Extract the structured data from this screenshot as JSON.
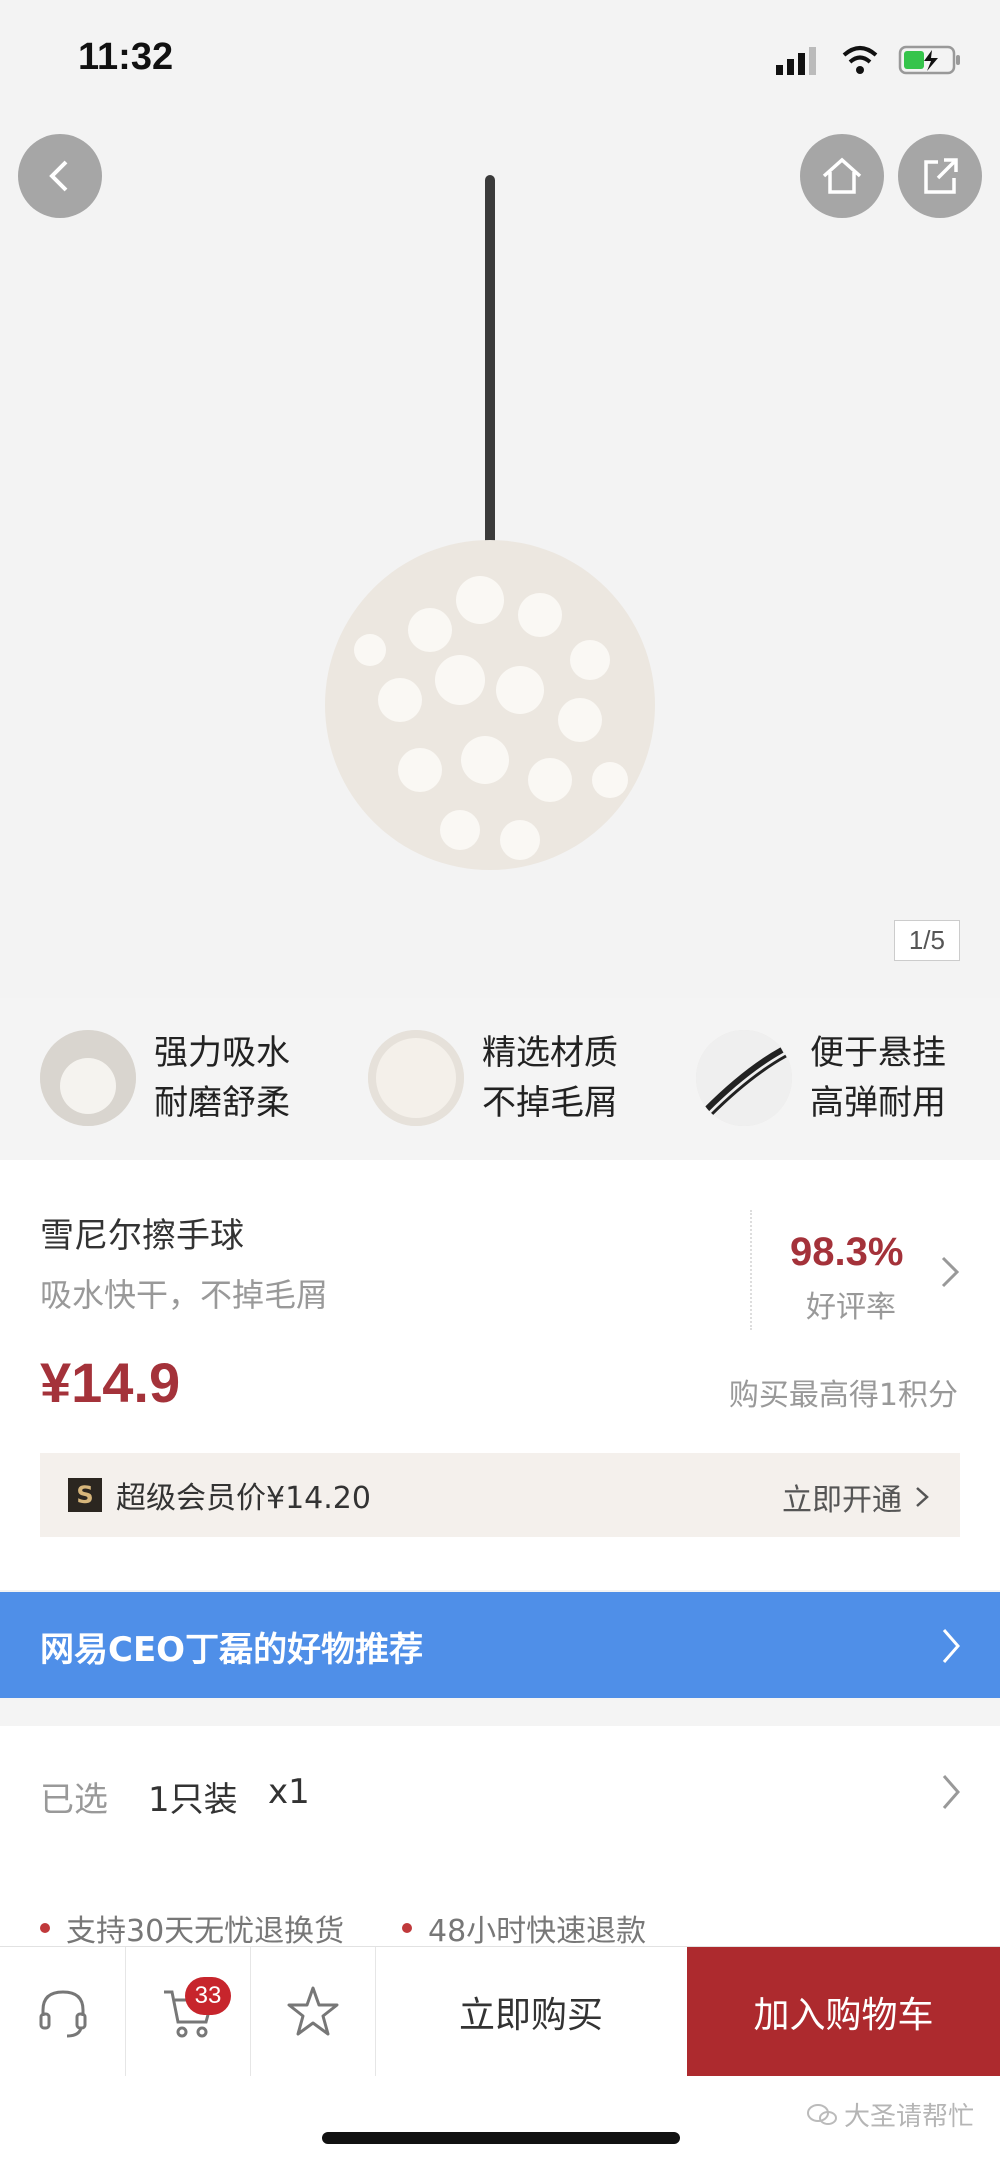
{
  "status_bar": {
    "time": "11:32"
  },
  "gallery": {
    "counter": "1/5"
  },
  "features": [
    {
      "line1": "强力吸水",
      "line2": "耐磨舒柔",
      "icon": "water-absorb-thumb"
    },
    {
      "line1": "精选材质",
      "line2": "不掉毛屑",
      "icon": "material-thumb"
    },
    {
      "line1": "便于悬挂",
      "line2": "高弹耐用",
      "icon": "hanging-cord-thumb"
    }
  ],
  "product": {
    "title": "雪尼尔擦手球",
    "subtitle": "吸水快干，不掉毛屑",
    "rating_value": "98.3%",
    "rating_label": "好评率",
    "price": "¥14.9",
    "points_text": "购买最高得1积分",
    "vip_text": "超级会员价¥14.20",
    "vip_badge": "S",
    "vip_action": "立即开通"
  },
  "banner": {
    "text": "网易CEO丁磊的好物推荐"
  },
  "selection": {
    "label": "已选",
    "value": "1只装",
    "quantity": "x1"
  },
  "services": [
    "支持30天无忧退换货",
    "48小时快速退款"
  ],
  "bottom_bar": {
    "cart_count": "33",
    "buy_now": "立即购买",
    "add_to_cart": "加入购物车"
  },
  "watermark": "大圣请帮忙",
  "colors": {
    "accent_red": "#ad2a2e",
    "price_red": "#a4323a",
    "banner_blue": "#4f8fe8"
  }
}
